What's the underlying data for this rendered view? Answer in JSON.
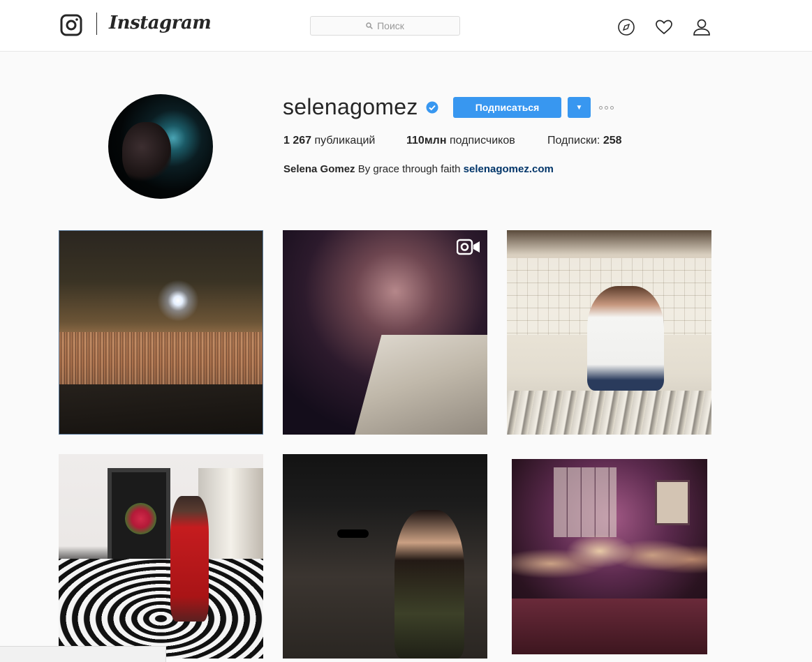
{
  "header": {
    "brand": "Instagram",
    "search_placeholder": "Поиск"
  },
  "profile": {
    "username": "selenagomez",
    "follow_label": "Подписаться",
    "stats": {
      "posts_count": "1 267",
      "posts_label": "публикаций",
      "followers_count": "110млн",
      "followers_label": "подписчиков",
      "following_label": "Подписки:",
      "following_count": "258"
    },
    "bio": {
      "full_name": "Selena Gomez",
      "text": "By grace through faith",
      "link": "selenagomez.com"
    }
  },
  "colors": {
    "accent": "#3897f0",
    "link": "#003569",
    "background": "#fafafa"
  },
  "icons": [
    "instagram-logo-icon",
    "search-icon",
    "explore-compass-icon",
    "heart-icon",
    "profile-icon",
    "verified-badge-icon",
    "video-camera-icon"
  ]
}
